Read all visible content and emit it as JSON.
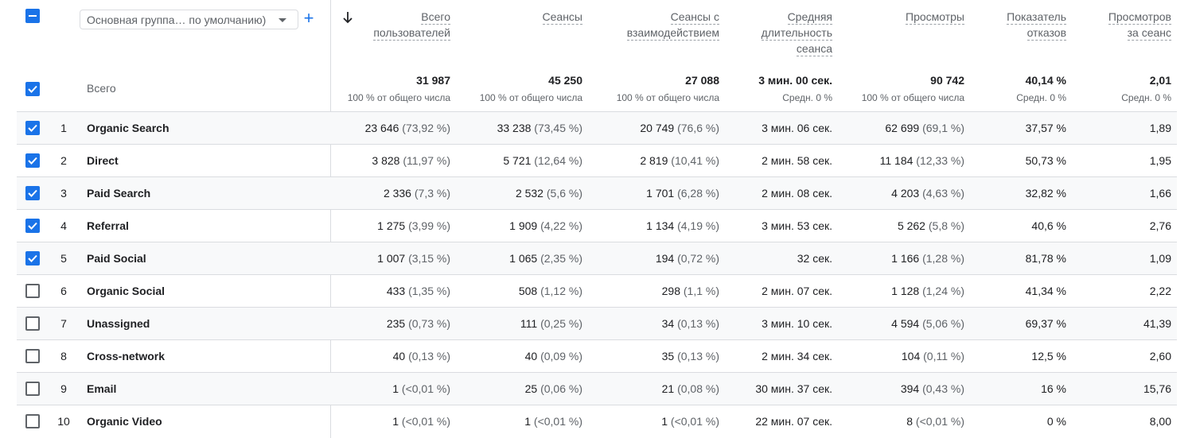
{
  "dimension_selector": {
    "label": "Основная группа… по умолчанию)"
  },
  "add_button": "+",
  "columns": [
    {
      "id": "users",
      "lines": [
        "Всего",
        "пользователей"
      ]
    },
    {
      "id": "sessions",
      "lines": [
        "Сеансы"
      ]
    },
    {
      "id": "engaged",
      "lines": [
        "Сеансы с",
        "взаимодействием"
      ]
    },
    {
      "id": "duration",
      "lines": [
        "Средняя",
        "длительность",
        "сеанса"
      ]
    },
    {
      "id": "views",
      "lines": [
        "Просмотры"
      ]
    },
    {
      "id": "bounce",
      "lines": [
        "Показатель",
        "отказов"
      ]
    },
    {
      "id": "views_per_session",
      "lines": [
        "Просмотров",
        "за сеанс"
      ]
    }
  ],
  "totals": {
    "label": "Всего",
    "values": [
      "31 987",
      "45 250",
      "27 088",
      "3 мин. 00 сек.",
      "90 742",
      "40,14 %",
      "2,01"
    ],
    "subs": [
      "100 % от общего числа",
      "100 % от общего числа",
      "100 % от общего числа",
      "Средн. 0 %",
      "100 % от общего числа",
      "Средн. 0 %",
      "Средн. 0 %"
    ]
  },
  "rows": [
    {
      "n": "1",
      "name": "Organic Search",
      "checked": true,
      "cells": [
        [
          "23 646",
          "(73,92 %)"
        ],
        [
          "33 238",
          "(73,45 %)"
        ],
        [
          "20 749",
          "(76,6 %)"
        ],
        [
          "3 мин. 06 сек.",
          ""
        ],
        [
          "62 699",
          "(69,1 %)"
        ],
        [
          "37,57 %",
          ""
        ],
        [
          "1,89",
          ""
        ]
      ]
    },
    {
      "n": "2",
      "name": "Direct",
      "checked": true,
      "cells": [
        [
          "3 828",
          "(11,97 %)"
        ],
        [
          "5 721",
          "(12,64 %)"
        ],
        [
          "2 819",
          "(10,41 %)"
        ],
        [
          "2 мин. 58 сек.",
          ""
        ],
        [
          "11 184",
          "(12,33 %)"
        ],
        [
          "50,73 %",
          ""
        ],
        [
          "1,95",
          ""
        ]
      ]
    },
    {
      "n": "3",
      "name": "Paid Search",
      "checked": true,
      "cells": [
        [
          "2 336",
          "(7,3 %)"
        ],
        [
          "2 532",
          "(5,6 %)"
        ],
        [
          "1 701",
          "(6,28 %)"
        ],
        [
          "2 мин. 08 сек.",
          ""
        ],
        [
          "4 203",
          "(4,63 %)"
        ],
        [
          "32,82 %",
          ""
        ],
        [
          "1,66",
          ""
        ]
      ]
    },
    {
      "n": "4",
      "name": "Referral",
      "checked": true,
      "cells": [
        [
          "1 275",
          "(3,99 %)"
        ],
        [
          "1 909",
          "(4,22 %)"
        ],
        [
          "1 134",
          "(4,19 %)"
        ],
        [
          "3 мин. 53 сек.",
          ""
        ],
        [
          "5 262",
          "(5,8 %)"
        ],
        [
          "40,6 %",
          ""
        ],
        [
          "2,76",
          ""
        ]
      ]
    },
    {
      "n": "5",
      "name": "Paid Social",
      "checked": true,
      "cells": [
        [
          "1 007",
          "(3,15 %)"
        ],
        [
          "1 065",
          "(2,35 %)"
        ],
        [
          "194",
          "(0,72 %)"
        ],
        [
          "32 сек.",
          ""
        ],
        [
          "1 166",
          "(1,28 %)"
        ],
        [
          "81,78 %",
          ""
        ],
        [
          "1,09",
          ""
        ]
      ]
    },
    {
      "n": "6",
      "name": "Organic Social",
      "checked": false,
      "cells": [
        [
          "433",
          "(1,35 %)"
        ],
        [
          "508",
          "(1,12 %)"
        ],
        [
          "298",
          "(1,1 %)"
        ],
        [
          "2 мин. 07 сек.",
          ""
        ],
        [
          "1 128",
          "(1,24 %)"
        ],
        [
          "41,34 %",
          ""
        ],
        [
          "2,22",
          ""
        ]
      ]
    },
    {
      "n": "7",
      "name": "Unassigned",
      "checked": false,
      "cells": [
        [
          "235",
          "(0,73 %)"
        ],
        [
          "111",
          "(0,25 %)"
        ],
        [
          "34",
          "(0,13 %)"
        ],
        [
          "3 мин. 10 сек.",
          ""
        ],
        [
          "4 594",
          "(5,06 %)"
        ],
        [
          "69,37 %",
          ""
        ],
        [
          "41,39",
          ""
        ]
      ]
    },
    {
      "n": "8",
      "name": "Cross-network",
      "checked": false,
      "cells": [
        [
          "40",
          "(0,13 %)"
        ],
        [
          "40",
          "(0,09 %)"
        ],
        [
          "35",
          "(0,13 %)"
        ],
        [
          "2 мин. 34 сек.",
          ""
        ],
        [
          "104",
          "(0,11 %)"
        ],
        [
          "12,5 %",
          ""
        ],
        [
          "2,60",
          ""
        ]
      ]
    },
    {
      "n": "9",
      "name": "Email",
      "checked": false,
      "cells": [
        [
          "1",
          "(<0,01 %)"
        ],
        [
          "25",
          "(0,06 %)"
        ],
        [
          "21",
          "(0,08 %)"
        ],
        [
          "30 мин. 37 сек.",
          ""
        ],
        [
          "394",
          "(0,43 %)"
        ],
        [
          "16 %",
          ""
        ],
        [
          "15,76",
          ""
        ]
      ]
    },
    {
      "n": "10",
      "name": "Organic Video",
      "checked": false,
      "cells": [
        [
          "1",
          "(<0,01 %)"
        ],
        [
          "1",
          "(<0,01 %)"
        ],
        [
          "1",
          "(<0,01 %)"
        ],
        [
          "22 мин. 07 сек.",
          ""
        ],
        [
          "8",
          "(<0,01 %)"
        ],
        [
          "0 %",
          ""
        ],
        [
          "8,00",
          ""
        ]
      ]
    }
  ]
}
